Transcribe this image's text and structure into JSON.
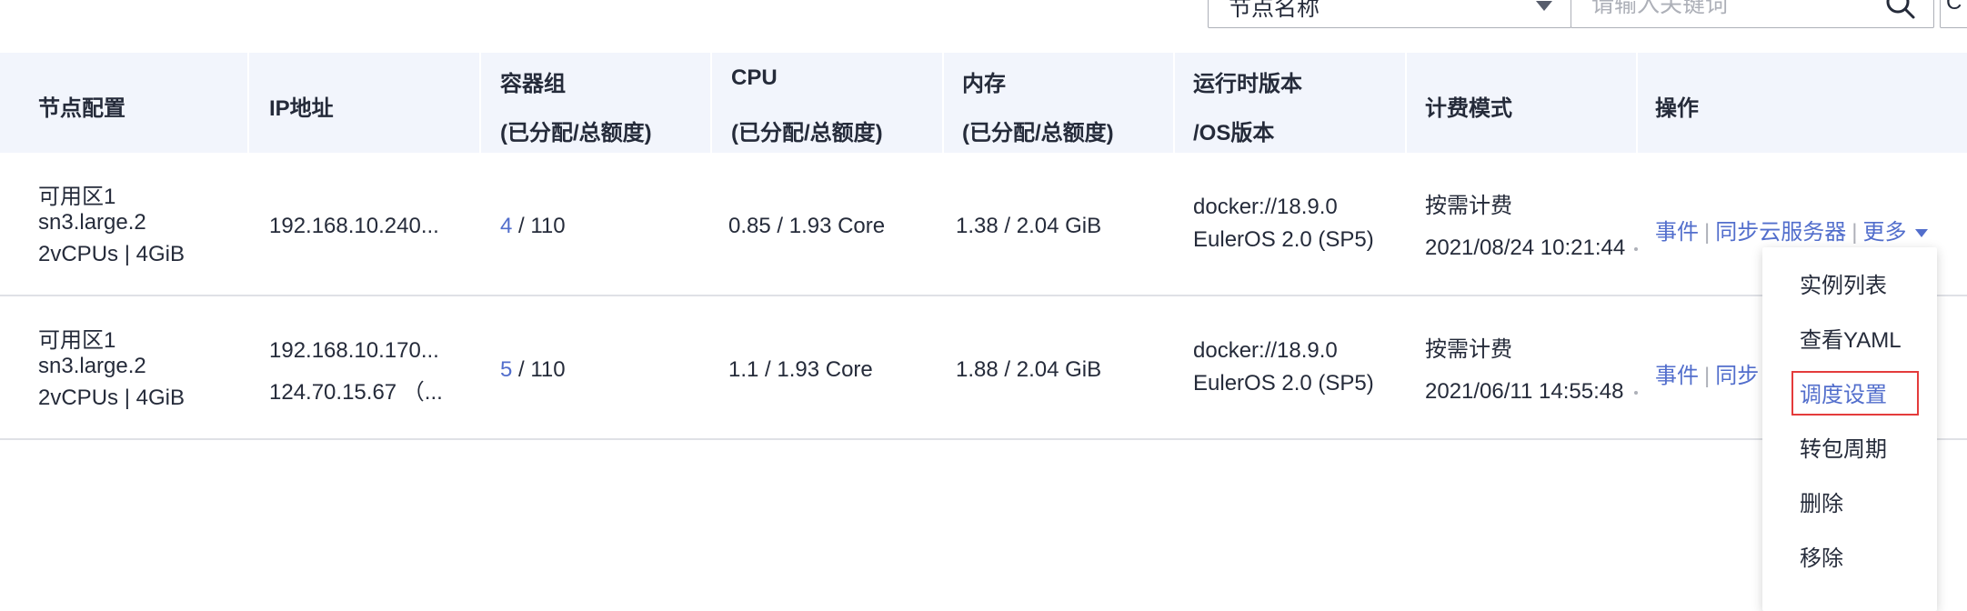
{
  "filter": {
    "select_value": "节点名称",
    "search_placeholder": "请输入关键词",
    "edge_button_label": "C"
  },
  "table": {
    "headers": {
      "config": "节点配置",
      "ip": "IP地址",
      "pods_l1": "容器组",
      "pods_l2": "(已分配/总额度)",
      "cpu_l1": "CPU",
      "cpu_l2": "(已分配/总额度)",
      "mem_l1": "内存",
      "mem_l2": "(已分配/总额度)",
      "runtime_l1": "运行时版本",
      "runtime_l2": "/OS版本",
      "billing": "计费模式",
      "ops": "操作"
    },
    "rows": [
      {
        "zone": "可用区1",
        "flavor": "sn3.large.2",
        "spec": "2vCPUs | 4GiB",
        "ip1": "192.168.10.240...",
        "ip2": "",
        "pods_alloc": "4",
        "pods_total": "/ 110",
        "cpu": "0.85 / 1.93 Core",
        "mem": "1.38 / 2.04 GiB",
        "runtime": "docker://18.9.0",
        "os": "EulerOS 2.0 (SP5)",
        "billing": "按需计费",
        "created": "2021/08/24 10:21:44",
        "op_events": "事件",
        "op_sync": "同步云服务器",
        "op_more": "更多"
      },
      {
        "zone": "可用区1",
        "flavor": "sn3.large.2",
        "spec": "2vCPUs | 4GiB",
        "ip1": "192.168.10.170...",
        "ip2": "124.70.15.67 （...",
        "pods_alloc": "5",
        "pods_total": "/ 110",
        "cpu": "1.1 / 1.93 Core",
        "mem": "1.88 / 2.04 GiB",
        "runtime": "docker://18.9.0",
        "os": "EulerOS 2.0 (SP5)",
        "billing": "按需计费",
        "created": "2021/06/11 14:55:48",
        "op_events": "事件",
        "op_sync": "同步"
      }
    ]
  },
  "menu": {
    "items": [
      "实例列表",
      "查看YAML",
      "调度设置",
      "转包周期",
      "删除",
      "移除"
    ],
    "active_item": "调度设置"
  },
  "colors": {
    "link": "#526ecc",
    "header_bg": "#f2f5fc",
    "highlight_border": "#e43b3b"
  }
}
